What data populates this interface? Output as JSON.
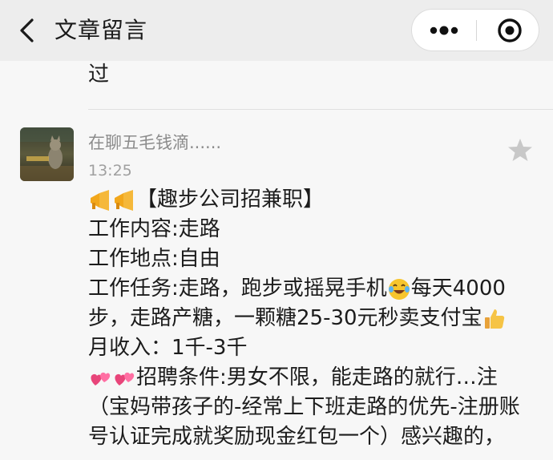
{
  "header": {
    "title": "文章留言",
    "back_icon": "chevron-left-icon",
    "more_icon": "more-dots-icon",
    "close_icon": "target-close-icon"
  },
  "previous_comment": {
    "tail_text": "过"
  },
  "comment": {
    "avatar_icon": "cat-photo-avatar",
    "username": "在聊五毛钱滴......",
    "time": "13:25",
    "star_icon": "star-icon",
    "lines": {
      "l1": "【趣步公司招兼职】",
      "l2": "工作内容:走路",
      "l3": "工作地点:自由",
      "l4a": "工作任务:走路，跑步或摇晃手机",
      "l4b": "每天4000",
      "l5": "步，走路产糖，一颗糖25-30元秒卖支付宝",
      "l6": "月收入：1千-3千",
      "l7": "招聘条件:男女不限，能走路的就行…注",
      "l8": "（宝妈带孩子的-经常上下班走路的优先-注册账",
      "l9": "号认证完成就奖励现金红包一个）感兴趣的，"
    },
    "emoji_names": [
      "megaphone-icon",
      "laughing-tears-icon",
      "thumbs-up-icon",
      "hearts-icon"
    ]
  },
  "colors": {
    "header_bg": "#ededed",
    "page_bg": "#f7f7f7",
    "text": "#1c1c1c",
    "meta_text": "#8c8c8c"
  }
}
